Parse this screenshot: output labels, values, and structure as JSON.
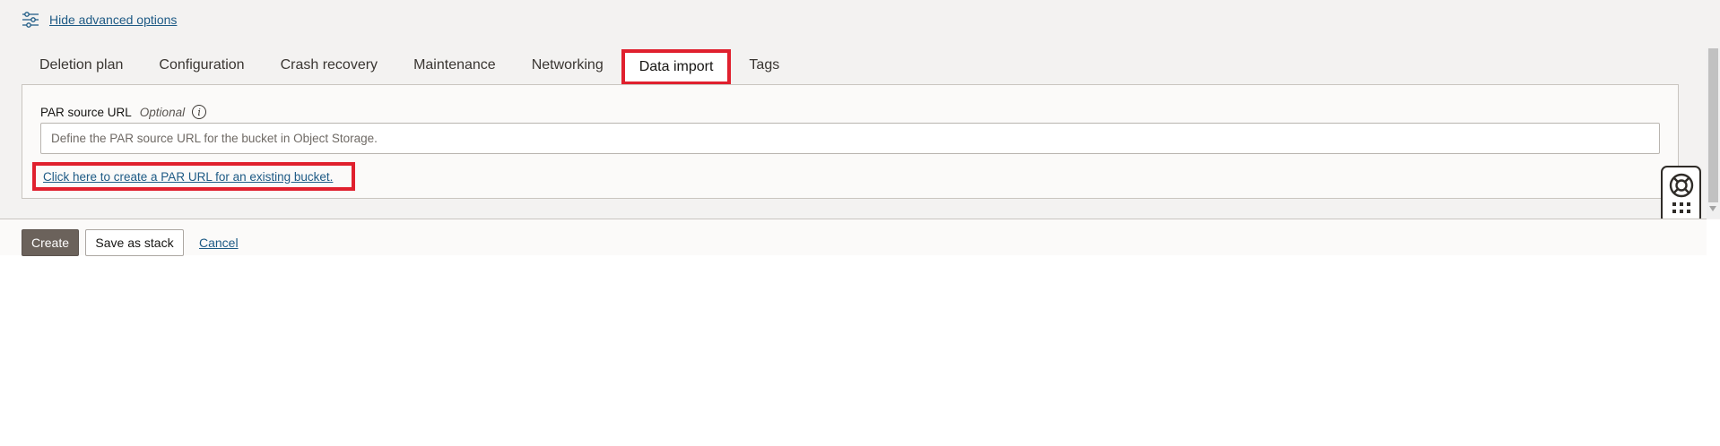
{
  "advanced": {
    "toggle_label": "Hide advanced options"
  },
  "tabs": [
    {
      "label": "Deletion plan"
    },
    {
      "label": "Configuration"
    },
    {
      "label": "Crash recovery"
    },
    {
      "label": "Maintenance"
    },
    {
      "label": "Networking"
    },
    {
      "label": "Data import",
      "active": true
    },
    {
      "label": "Tags"
    }
  ],
  "data_import": {
    "field_label": "PAR source URL",
    "optional_label": "Optional",
    "info_icon": "info-icon",
    "input_value": "",
    "input_placeholder": "Define the PAR source URL for the bucket in Object Storage.",
    "par_link_text": "Click here to create a PAR URL for an existing bucket."
  },
  "footer": {
    "create_label": "Create",
    "save_stack_label": "Save as stack",
    "cancel_label": "Cancel"
  },
  "help_widget": {
    "icon": "lifebuoy-icon",
    "menu_icon": "app-grid-icon"
  },
  "colors": {
    "highlight": "#e0202e",
    "link": "#1d5a85",
    "primary_button": "#6b625b",
    "panel_bg": "#f3f2f1"
  }
}
